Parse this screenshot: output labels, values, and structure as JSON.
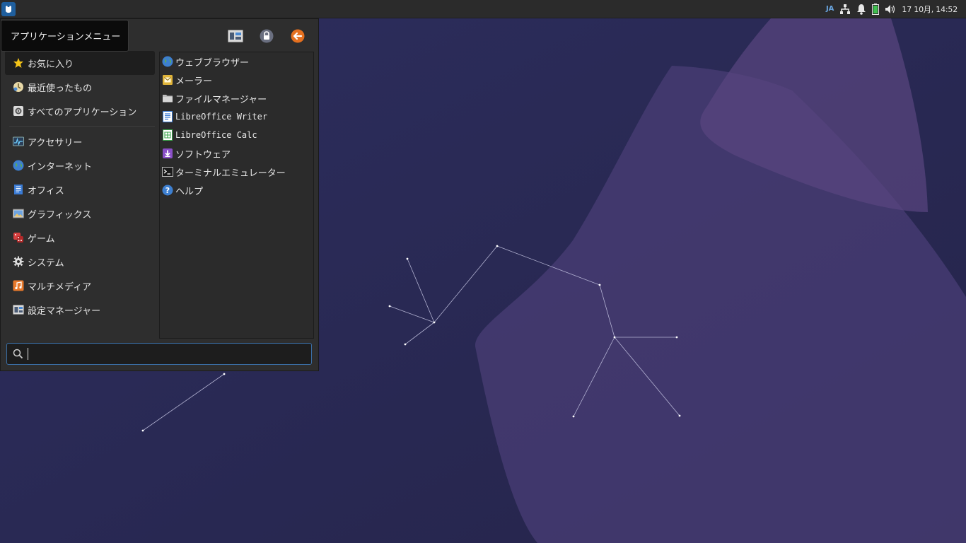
{
  "tooltip": {
    "text": "アプリケーションメニュー"
  },
  "panel": {
    "keyboard_layout": "JA",
    "clock": "17 10月, 14:52",
    "icons": [
      "xfce-menu-icon",
      "network-icon",
      "bell-icon",
      "battery-icon",
      "volume-icon"
    ]
  },
  "menu": {
    "header_buttons": [
      "settings-icon",
      "lock-icon",
      "logout-icon"
    ],
    "categories_top": [
      {
        "label": "お気に入り",
        "icon": "star-icon",
        "active": true
      },
      {
        "label": "最近使ったもの",
        "icon": "recent-icon"
      },
      {
        "label": "すべてのアプリケーション",
        "icon": "all-apps-icon"
      }
    ],
    "categories": [
      {
        "label": "アクセサリー",
        "icon": "accessories-icon"
      },
      {
        "label": "インターネット",
        "icon": "internet-icon"
      },
      {
        "label": "オフィス",
        "icon": "office-icon"
      },
      {
        "label": "グラフィックス",
        "icon": "graphics-icon"
      },
      {
        "label": "ゲーム",
        "icon": "games-icon"
      },
      {
        "label": "システム",
        "icon": "system-icon"
      },
      {
        "label": "マルチメディア",
        "icon": "multimedia-icon"
      },
      {
        "label": "設定マネージャー",
        "icon": "settings-manager-icon"
      }
    ],
    "apps": [
      {
        "label": "ウェブブラウザー",
        "icon": "web-browser-icon"
      },
      {
        "label": "メーラー",
        "icon": "mail-icon"
      },
      {
        "label": "ファイルマネージャー",
        "icon": "folder-icon"
      },
      {
        "label": "LibreOffice Writer",
        "icon": "writer-icon"
      },
      {
        "label": "LibreOffice Calc",
        "icon": "calc-icon"
      },
      {
        "label": "ソフトウェア",
        "icon": "software-icon"
      },
      {
        "label": "ターミナルエミュレーター",
        "icon": "terminal-icon"
      },
      {
        "label": "ヘルプ",
        "icon": "help-icon"
      }
    ],
    "search": {
      "value": "",
      "icon": "search-icon"
    }
  }
}
